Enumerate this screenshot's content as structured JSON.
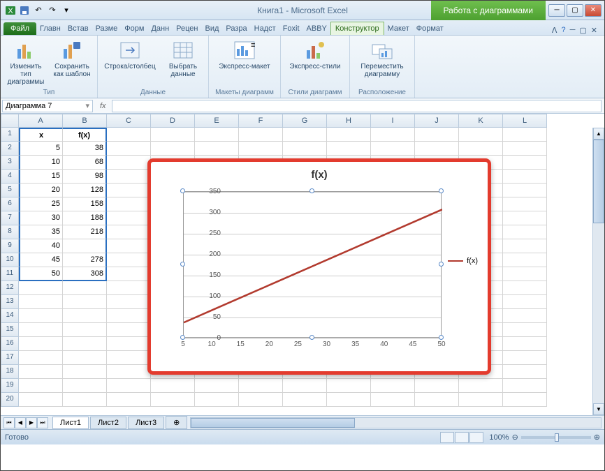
{
  "title": "Книга1 - Microsoft Excel",
  "chart_tools_label": "Работа с диаграммами",
  "file_tab": "Файл",
  "tabs": [
    "Главн",
    "Встав",
    "Разме",
    "Форм",
    "Данн",
    "Рецен",
    "Вид",
    "Разра",
    "Надст",
    "Foxit",
    "ABBY"
  ],
  "chart_tabs": [
    "Конструктор",
    "Макет",
    "Формат"
  ],
  "ribbon": {
    "change_type": "Изменить тип\nдиаграммы",
    "save_tpl": "Сохранить\nкак шаблон",
    "grp_type": "Тип",
    "switch": "Строка/столбец",
    "select_data": "Выбрать\nданные",
    "grp_data": "Данные",
    "layout": "Экспресс-макет",
    "grp_layouts": "Макеты диаграмм",
    "styles": "Экспресс-стили",
    "grp_styles": "Стили диаграмм",
    "move": "Переместить\nдиаграмму",
    "grp_loc": "Расположение"
  },
  "name_box": "Диаграмма 7",
  "fx": "fx",
  "columns": [
    "A",
    "B",
    "C",
    "D",
    "E",
    "F",
    "G",
    "H",
    "I",
    "J",
    "K",
    "L"
  ],
  "table": {
    "headers": {
      "x": "x",
      "fx": "f(x)"
    },
    "rows": [
      {
        "n": 2,
        "x": 5,
        "f": 38
      },
      {
        "n": 3,
        "x": 10,
        "f": 68
      },
      {
        "n": 4,
        "x": 15,
        "f": 98
      },
      {
        "n": 5,
        "x": 20,
        "f": 128
      },
      {
        "n": 6,
        "x": 25,
        "f": 158
      },
      {
        "n": 7,
        "x": 30,
        "f": 188
      },
      {
        "n": 8,
        "x": 35,
        "f": 218
      },
      {
        "n": 9,
        "x": 40,
        "f": ""
      },
      {
        "n": 10,
        "x": 45,
        "f": 278
      },
      {
        "n": 11,
        "x": 50,
        "f": 308
      }
    ]
  },
  "chart_data": {
    "type": "line",
    "title": "f(x)",
    "series": [
      {
        "name": "f(x)",
        "x": [
          5,
          10,
          15,
          20,
          25,
          30,
          35,
          40,
          45,
          50
        ],
        "y": [
          38,
          68,
          98,
          128,
          158,
          188,
          218,
          null,
          278,
          308
        ]
      }
    ],
    "x_ticks": [
      5,
      10,
      15,
      20,
      25,
      30,
      35,
      40,
      45,
      50
    ],
    "y_ticks": [
      0,
      50,
      100,
      150,
      200,
      250,
      300,
      350
    ],
    "xlim": [
      5,
      50
    ],
    "ylim": [
      0,
      350
    ],
    "legend": "f(x)"
  },
  "sheets": [
    "Лист1",
    "Лист2",
    "Лист3"
  ],
  "status_ready": "Готово",
  "zoom": "100%"
}
